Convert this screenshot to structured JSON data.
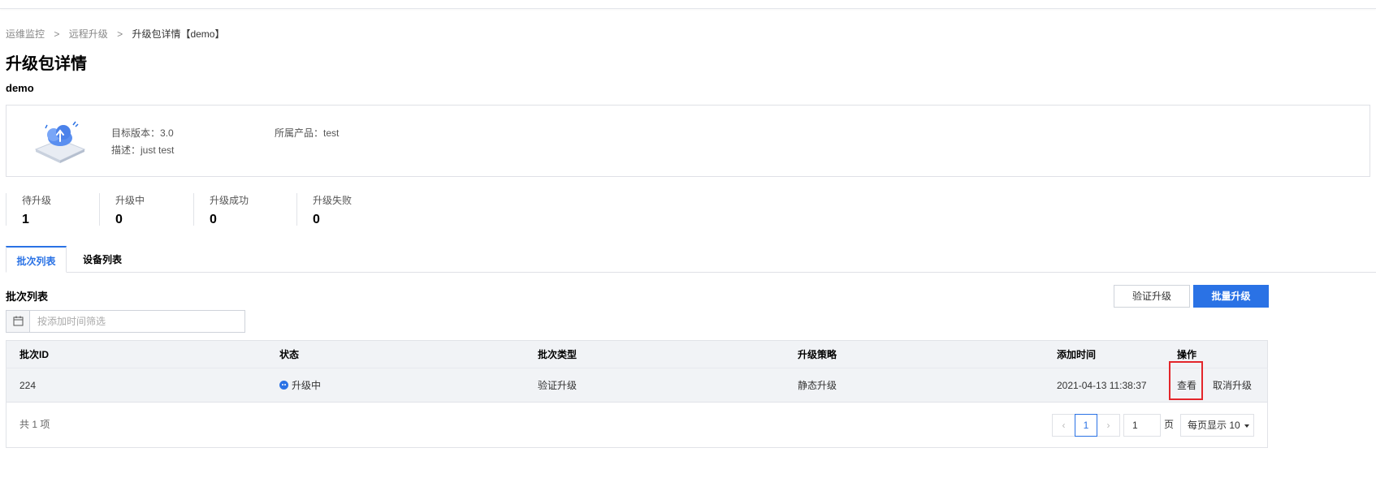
{
  "breadcrumb": {
    "items": [
      "运维监控",
      "远程升级",
      "升级包详情【demo】"
    ],
    "separator": ">"
  },
  "page": {
    "title": "升级包详情",
    "package_name": "demo"
  },
  "info_card": {
    "target_version_label": "目标版本：",
    "target_version": "3.0",
    "description_label": "描述：",
    "description": "just test",
    "product_label": "所属产品：",
    "product": "test"
  },
  "stats": [
    {
      "label": "待升级",
      "value": "1"
    },
    {
      "label": "升级中",
      "value": "0"
    },
    {
      "label": "升级成功",
      "value": "0"
    },
    {
      "label": "升级失败",
      "value": "0"
    }
  ],
  "tabs": [
    {
      "label": "批次列表",
      "active": true
    },
    {
      "label": "设备列表",
      "active": false
    }
  ],
  "section": {
    "title": "批次列表",
    "verify_button": "验证升级",
    "batch_button": "批量升级",
    "date_filter_placeholder": "按添加时间筛选"
  },
  "table": {
    "columns": [
      "批次ID",
      "状态",
      "批次类型",
      "升级策略",
      "添加时间",
      "操作"
    ],
    "rows": [
      {
        "id": "224",
        "status": "升级中",
        "batch_type": "验证升级",
        "strategy": "静态升级",
        "added_time": "2021-04-13 11:38:37",
        "actions": [
          "查看",
          "取消升级"
        ]
      }
    ]
  },
  "pagination": {
    "total": "共 1 项",
    "prev": "‹",
    "current_page": "1",
    "next": "›",
    "page_input": "1",
    "page_unit": "页",
    "page_size": "每页显示 10"
  },
  "colors": {
    "accent": "#2a72e5",
    "highlight_box": "#e3262b",
    "table_bg": "#f1f3f6"
  },
  "icons": {
    "calendar": "calendar-icon",
    "status": "status-running-icon",
    "illustration": "cloud-upgrade-illustration"
  }
}
